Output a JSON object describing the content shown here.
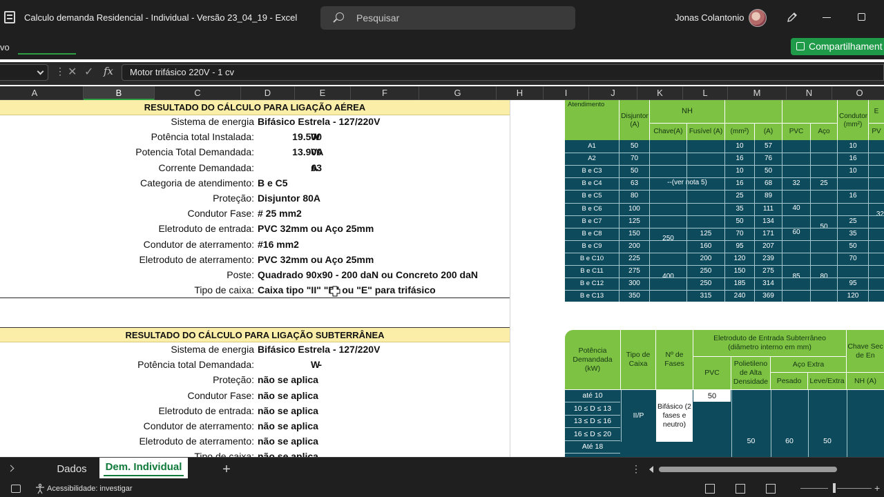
{
  "window": {
    "title": "Calculo demanda Residencial - Individual - Versão 23_04_19  -  Excel",
    "user": "Jonas Colantonio"
  },
  "search": {
    "placeholder": "Pesquisar"
  },
  "ribbon": {
    "partial_tab": "vo",
    "share_label": "Compartilhament"
  },
  "formula_bar": {
    "value": "Motor trifásico 220V - 1 cv"
  },
  "columns": [
    "A",
    "B",
    "C",
    "D",
    "E",
    "F",
    "G",
    "H",
    "I",
    "J",
    "K",
    "L",
    "M",
    "N",
    "O"
  ],
  "aerea": {
    "header": "RESULTADO DO CÁLCULO PARA LIGAÇÃO AÉREA",
    "rows": [
      {
        "label": "Sistema de energia",
        "value": "Bifásico Estrela - 127/220V"
      },
      {
        "label": "Potência total Instalada:",
        "num": "19.500",
        "unit": "W"
      },
      {
        "label": "Potencia Total Demandada:",
        "num": "13.900",
        "unit": "VA"
      },
      {
        "label": "Corrente Demandada:",
        "num": "63",
        "unit": "A"
      },
      {
        "label": "Categoria de atendimento:",
        "value": "B e C5"
      },
      {
        "label": "Proteção:",
        "value": "Disjuntor 80A"
      },
      {
        "label": "Condutor Fase:",
        "value": "# 25 mm2"
      },
      {
        "label": "Eletroduto de entrada:",
        "value": "PVC 32mm ou Aço 25mm"
      },
      {
        "label": "Condutor de aterramento:",
        "value": "#16 mm2"
      },
      {
        "label": "Eletroduto de aterramento:",
        "value": "PVC 32mm ou Aço 25mm"
      },
      {
        "label": "Poste:",
        "value": "Quadrado 90x90 - 200 daN ou Concreto 200 daN"
      },
      {
        "label": "Tipo de caixa:",
        "value": "Caixa tipo \"II\"     \"P\" ou \"E\" para trifásico"
      }
    ]
  },
  "subterranea": {
    "header": "RESULTADO DO CÁLCULO PARA LIGAÇÃO SUBTERRÂNEA",
    "rows": [
      {
        "label": "Sistema de energia",
        "value": "Bifásico Estrela - 127/220V"
      },
      {
        "label": "Potência total Demandada:",
        "num": "-",
        "unit": "W"
      },
      {
        "label": "Proteção:",
        "value": "não se aplica"
      },
      {
        "label": "Condutor Fase:",
        "value": "não se aplica"
      },
      {
        "label": "Eletroduto de entrada:",
        "value": "não se aplica"
      },
      {
        "label": "Condutor de aterramento:",
        "value": "não se aplica"
      },
      {
        "label": "Eletroduto de aterramento:",
        "value": "não se aplica"
      },
      {
        "label": "Tipo de caixa:",
        "value": "não se aplica"
      }
    ]
  },
  "table1": {
    "head_atendimento": "Atendimento",
    "head_disjuntor": "Disjuntor (A)",
    "head_nh": "NH",
    "head_chave": "Chave(A)",
    "head_fusivel": "Fusível (A)",
    "head_mm2": "(mm²)",
    "head_a": "(A)",
    "head_pvc": "PVC",
    "head_aco": "Aço",
    "head_condutor": "Condutor (mm²)",
    "head_pv": "PV",
    "head_e": "E",
    "ver_nota": "--(ver nota 5)",
    "rows": [
      {
        "cat": "A1",
        "disj": "50",
        "mm2": "10",
        "a": "57",
        "cond": "10"
      },
      {
        "cat": "A2",
        "disj": "70",
        "mm2": "16",
        "a": "76",
        "cond": "16"
      },
      {
        "cat": "B e C3",
        "disj": "50",
        "mm2": "10",
        "a": "50",
        "cond": "10"
      },
      {
        "cat": "B e C4",
        "disj": "63",
        "mm2": "16",
        "a": "68",
        "cond": ""
      },
      {
        "cat": "B e C5",
        "disj": "80",
        "mm2": "25",
        "a": "89",
        "cond": ""
      },
      {
        "cat": "B e C6",
        "disj": "100",
        "mm2": "35",
        "a": "111",
        "cond": ""
      },
      {
        "cat": "B e C7",
        "disj": "125",
        "mm2": "50",
        "a": "134",
        "cond": "25"
      },
      {
        "cat": "B e C8",
        "disj": "150",
        "fus": "125",
        "mm2": "70",
        "a": "171",
        "cond": "35"
      },
      {
        "cat": "B e C9",
        "disj": "200",
        "fus": "160",
        "mm2": "95",
        "a": "207",
        "cond": "50"
      },
      {
        "cat": "B e C10",
        "disj": "225",
        "fus": "200",
        "mm2": "120",
        "a": "239",
        "cond": "70"
      },
      {
        "cat": "B e C11",
        "disj": "275",
        "fus": "250",
        "mm2": "150",
        "a": "275",
        "cond": ""
      },
      {
        "cat": "B e C12",
        "disj": "300",
        "fus": "250",
        "mm2": "185",
        "a": "314",
        "cond": "95"
      },
      {
        "cat": "B e C13",
        "disj": "350",
        "fus": "315",
        "mm2": "240",
        "a": "369",
        "cond": "120"
      }
    ],
    "pvc_vals": [
      "32",
      "40",
      "60",
      "85"
    ],
    "aco_vals": [
      "25",
      "50",
      "80"
    ],
    "cond_merged": "16",
    "chave_vals": [
      "250",
      "400"
    ],
    "edge_val": "32"
  },
  "table2": {
    "h_potencia": "Potência Demandada (kW)",
    "h_tipo": "Tipo de Caixa",
    "h_fases": "Nº de Fases",
    "h_eletroduto": "Eletroduto de Entrada Subterrâneo (diâmetro interno em mm)",
    "h_pvc": "PVC",
    "h_polietileno": "Polietileno de Alta Densidade",
    "h_aco": "Aço Extra",
    "h_pesado": "Pesado",
    "h_leve": "Leve/Extra",
    "h_chave": "Chave Sec de En",
    "h_nh": "NH (A)",
    "rows": [
      "até 10",
      "10 ≤ D ≤ 13",
      "13 ≤ D ≤ 16",
      "16 ≤ D ≤ 20",
      "Até 18"
    ],
    "tipo": "II/P",
    "fases": "Bifásico (2 fases e neutro)",
    "pvc_val": "50",
    "pol_val": "50",
    "pes_val": "60",
    "lev_val": "50"
  },
  "sheet_tabs": [
    {
      "label": "Dados",
      "active": false
    },
    {
      "label": "Dem. Individual",
      "active": true
    }
  ],
  "status": {
    "accessibility": "Acessibilidade: investigar"
  },
  "colors": {
    "header_band": "#fbeea8",
    "table_green": "#7dc242",
    "table_teal": "#0c4a5c",
    "excel_green": "#1f9a48"
  }
}
